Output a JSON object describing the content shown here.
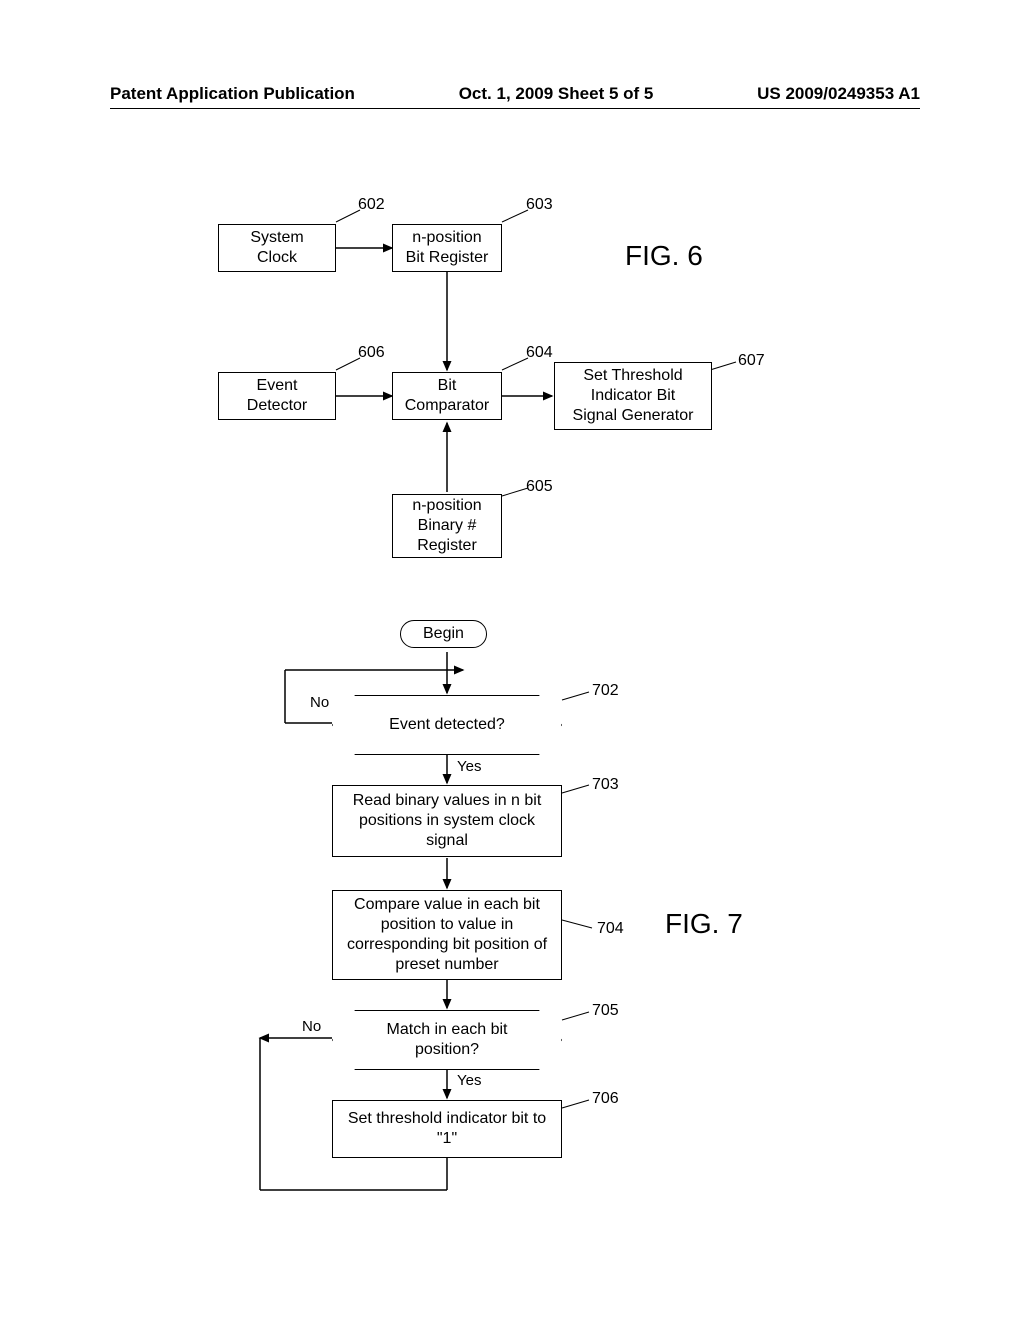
{
  "header": {
    "left": "Patent Application Publication",
    "center": "Oct. 1, 2009  Sheet 5 of 5",
    "right": "US 2009/0249353 A1"
  },
  "fig6": {
    "label": "FIG. 6",
    "boxes": {
      "system_clock": "System\nClock",
      "npos_bit_register": "n-position\nBit Register",
      "event_detector": "Event\nDetector",
      "bit_comparator": "Bit\nComparator",
      "set_threshold": "Set Threshold\nIndicator Bit\nSignal Generator",
      "npos_binary_register": "n-position\nBinary #\nRegister"
    },
    "refs": {
      "r602": "602",
      "r603": "603",
      "r606": "606",
      "r604": "604",
      "r607": "607",
      "r605": "605"
    }
  },
  "fig7": {
    "label": "FIG. 7",
    "begin": "Begin",
    "d702": "Event detected?",
    "b703": "Read binary values in n bit positions in system clock signal",
    "b704": "Compare value in each bit position to value in corresponding bit position of preset number",
    "d705": "Match in each bit position?",
    "b706": "Set threshold indicator bit to  \"1\"",
    "refs": {
      "r702": "702",
      "r703": "703",
      "r704": "704",
      "r705": "705",
      "r706": "706"
    },
    "branches": {
      "no": "No",
      "yes": "Yes"
    }
  }
}
